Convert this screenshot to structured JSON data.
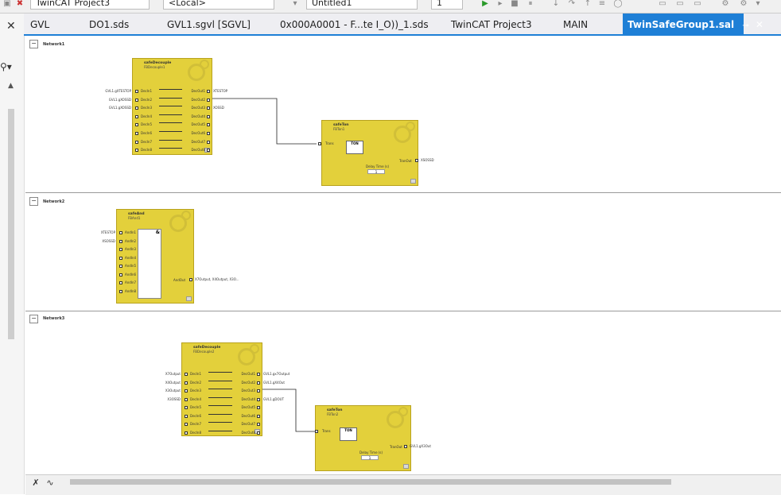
{
  "toolbar": {
    "project": "TwinCAT Project3",
    "target": "<Local>",
    "doc": "Untitled1",
    "zoom": "1"
  },
  "tabs": [
    {
      "label": "GVL"
    },
    {
      "label": "DO1.sds"
    },
    {
      "label": "GVL1.sgvl [SGVL]"
    },
    {
      "label": "0x000A0001 - F...te I_O))_1.sds"
    },
    {
      "label": "TwinCAT Project3"
    },
    {
      "label": "MAIN"
    },
    {
      "label": "TwinSafeGroup1.sal"
    }
  ],
  "active_tab": {
    "pin": "⊸",
    "close": "✕"
  },
  "close_glyph": "✕",
  "networks": [
    {
      "label": "Network1",
      "blocks": [
        {
          "title": "safeDecouple",
          "name": "FBDecouple1",
          "inputs": [
            "DecIn1",
            "DecIn2",
            "DecIn3",
            "DecIn4",
            "DecIn5",
            "DecIn6",
            "DecIn7",
            "DecIn8"
          ],
          "outputs": [
            "DecOut1",
            "DecOut2",
            "DecOut3",
            "DecOut4",
            "DecOut5",
            "DecOut6",
            "DecOut7",
            "DecOut8"
          ],
          "in_vars": [
            "GVL1.gXTESTOP",
            "GVL1.gXOSSD",
            "GVL1.gXOSSD"
          ],
          "out_vars": [
            "XTESTOP",
            "",
            "XOSSD"
          ]
        },
        {
          "title": "safeTon",
          "name": "FBTon1",
          "input": "Trans",
          "output": "TranOut",
          "out_var": "XSOSSD",
          "ton": "TON",
          "delay_label": "Delay Time (s)",
          "delay_value": "1"
        }
      ]
    },
    {
      "label": "Network2",
      "blocks": [
        {
          "title": "safeAnd",
          "name": "FBAnd1",
          "inputs": [
            "AndIn1",
            "AndIn2",
            "AndIn3",
            "AndIn4",
            "AndIn5",
            "AndIn6",
            "AndIn7",
            "AndIn8"
          ],
          "in_vars": [
            "XTESTOP",
            "XSOSSD"
          ],
          "output": "AndOut",
          "out_var": "X7Output, X4Output, X3O..."
        }
      ]
    },
    {
      "label": "Network3",
      "blocks": [
        {
          "title": "safeDecouple",
          "name": "FBDecouple2",
          "inputs": [
            "DecIn1",
            "DecIn2",
            "DecIn3",
            "DecIn4",
            "DecIn5",
            "DecIn6",
            "DecIn7",
            "DecIn8"
          ],
          "outputs": [
            "DecOut1",
            "DecOut2",
            "DecOut3",
            "DecOut4",
            "DecOut5",
            "DecOut6",
            "DecOut7",
            "DecOut8"
          ],
          "in_vars": [
            "X7Output",
            "X4Output",
            "X3Output",
            "X3OSSD"
          ],
          "out_vars": [
            "GVL1.gx7Output",
            "GVL1.gX4Out",
            "",
            "GVL1.gDOUT"
          ]
        },
        {
          "title": "safeTon",
          "name": "FBTon2",
          "input": "Trans",
          "output": "TranOut",
          "out_var": "GVL1.gX3Out",
          "ton": "TON",
          "delay_label": "Delay Time (s)",
          "delay_value": "1"
        }
      ]
    }
  ],
  "bottom": {
    "tool1": "✗",
    "tool2": "∿"
  },
  "colors": {
    "fb_fill": "#e3d03b",
    "accent": "#1e7fd6"
  }
}
